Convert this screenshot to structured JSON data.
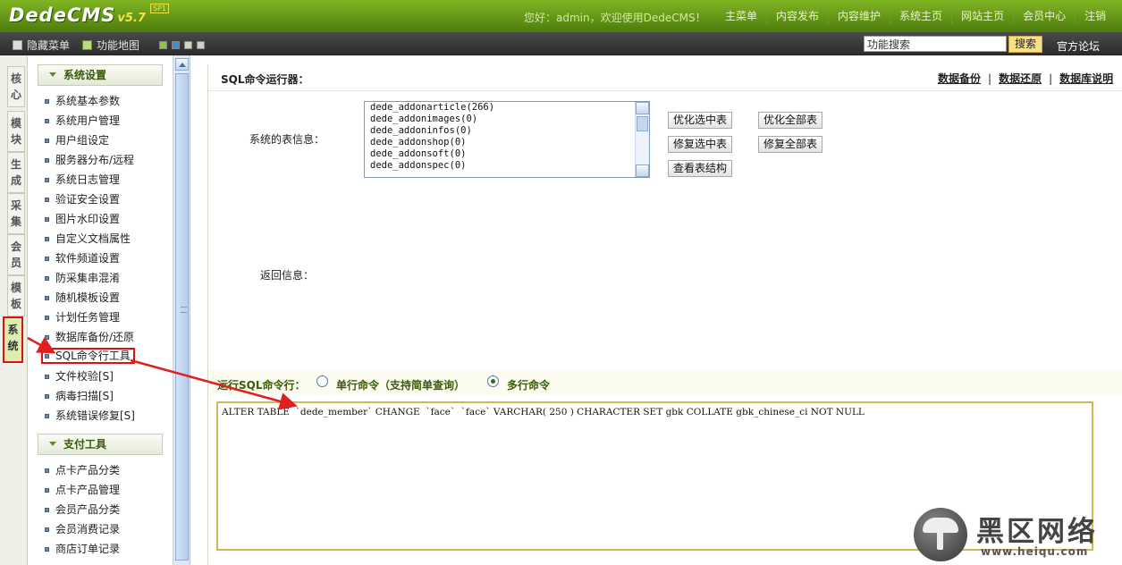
{
  "app": {
    "name": "DedeCMS",
    "version": "v5.7",
    "edition": "SP1"
  },
  "topbar": {
    "greeting": "您好：admin，欢迎使用DedeCMS！",
    "nav": [
      "主菜单",
      "内容发布",
      "内容维护",
      "系统主页",
      "网站主页",
      "会员中心",
      "注销"
    ]
  },
  "subbar": {
    "hide_menu": "隐藏菜单",
    "func_map": "功能地图",
    "swatch_colors": [
      "#8cc63f",
      "#3a8fd6",
      "#d0d8b8",
      "#cfcfcf"
    ],
    "search_value": "功能搜索",
    "search_button": "搜索",
    "forum": "官方论坛"
  },
  "left_tabs": [
    "核心",
    "模块",
    "生成",
    "采集",
    "会员",
    "模板",
    "系统"
  ],
  "sidebar": {
    "section1": "系统设置",
    "items1": [
      "系统基本参数",
      "系统用户管理",
      "用户组设定",
      "服务器分布/远程",
      "系统日志管理",
      "验证安全设置",
      "图片水印设置",
      "自定义文档属性",
      "软件频道设置",
      "防采集串混淆",
      "随机模板设置",
      "计划任务管理",
      "数据库备份/还原",
      "SQL命令行工具",
      "文件校验[S]",
      "病毒扫描[S]",
      "系统错误修复[S]"
    ],
    "section2": "支付工具",
    "items2": [
      "点卡产品分类",
      "点卡产品管理",
      "会员产品分类",
      "会员消费记录",
      "商店订单记录"
    ]
  },
  "main": {
    "title": "SQL命令运行器：",
    "header_links": [
      "数据备份",
      "数据还原",
      "数据库说明"
    ],
    "tables_label": "系统的表信息：",
    "tables": [
      "dede_addonarticle(266)",
      "dede_addonimages(0)",
      "dede_addoninfos(0)",
      "dede_addonshop(0)",
      "dede_addonsoft(0)",
      "dede_addonspec(0)"
    ],
    "buttons": {
      "optimize_selected": "优化选中表",
      "optimize_all": "优化全部表",
      "repair_selected": "修复选中表",
      "repair_all": "修复全部表",
      "view_structure": "查看表结构"
    },
    "return_label": "返回信息：",
    "run_label": "运行SQL命令行：",
    "radio_single": "单行命令（支持简单查询）",
    "radio_multi": "多行命令",
    "sql_text": "ALTER TABLE  `dede_member` CHANGE  `face`  `face` VARCHAR( 250 ) CHARACTER SET gbk COLLATE gbk_chinese_ci NOT NULL"
  },
  "watermark": {
    "title": "黑区网络",
    "url": "www.heiqu.com"
  },
  "colors": {
    "header_green": "#6a9a1c",
    "highlight_red": "#d11",
    "section_text": "#3a5b0a"
  }
}
